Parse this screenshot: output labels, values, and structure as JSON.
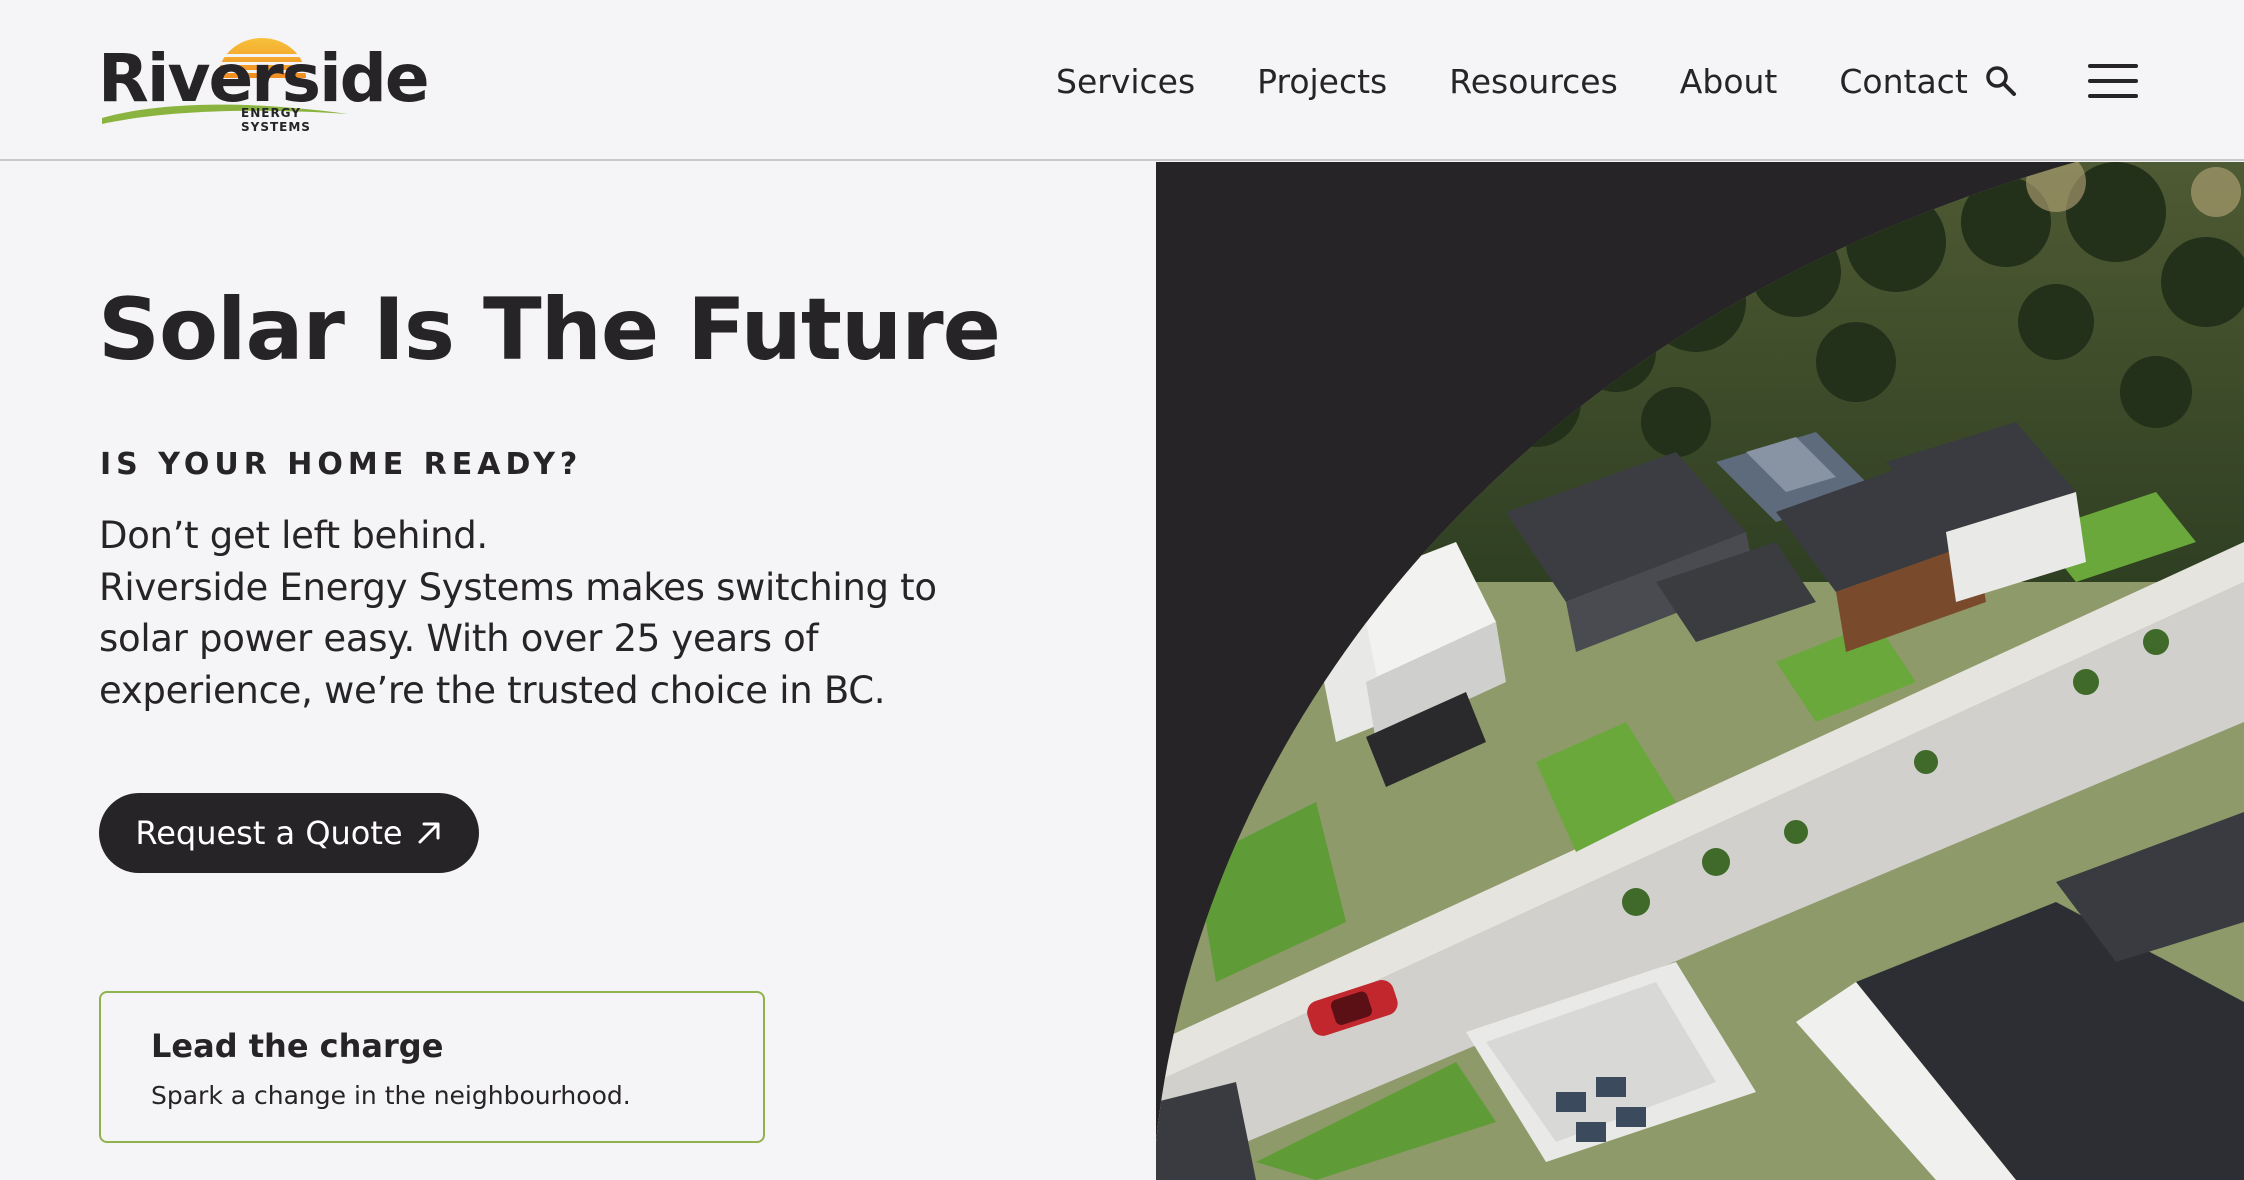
{
  "header": {
    "logo": {
      "word": "Riverside",
      "sub": "ENERGY SYSTEMS"
    },
    "nav": [
      {
        "label": "Services"
      },
      {
        "label": "Projects"
      },
      {
        "label": "Resources"
      },
      {
        "label": "About"
      },
      {
        "label": "Contact"
      }
    ],
    "icons": {
      "search": "search-icon",
      "menu": "hamburger-menu-icon"
    }
  },
  "hero": {
    "title": "Solar Is The Future",
    "eyebrow": "IS YOUR HOME READY?",
    "body_lines": [
      "Don’t get left behind.",
      "Riverside Energy Systems makes switching to",
      "solar power easy. With over 25 years of",
      "experience, we’re the trusted choice in BC."
    ],
    "cta_label": "Request a Quote"
  },
  "card": {
    "title": "Lead the charge",
    "text": "Spark a change in the neighbourhood."
  },
  "colors": {
    "dark": "#262427",
    "background": "#f5f4f6",
    "accent_green": "#8fb24d",
    "sun_orange": "#f2a42a"
  }
}
